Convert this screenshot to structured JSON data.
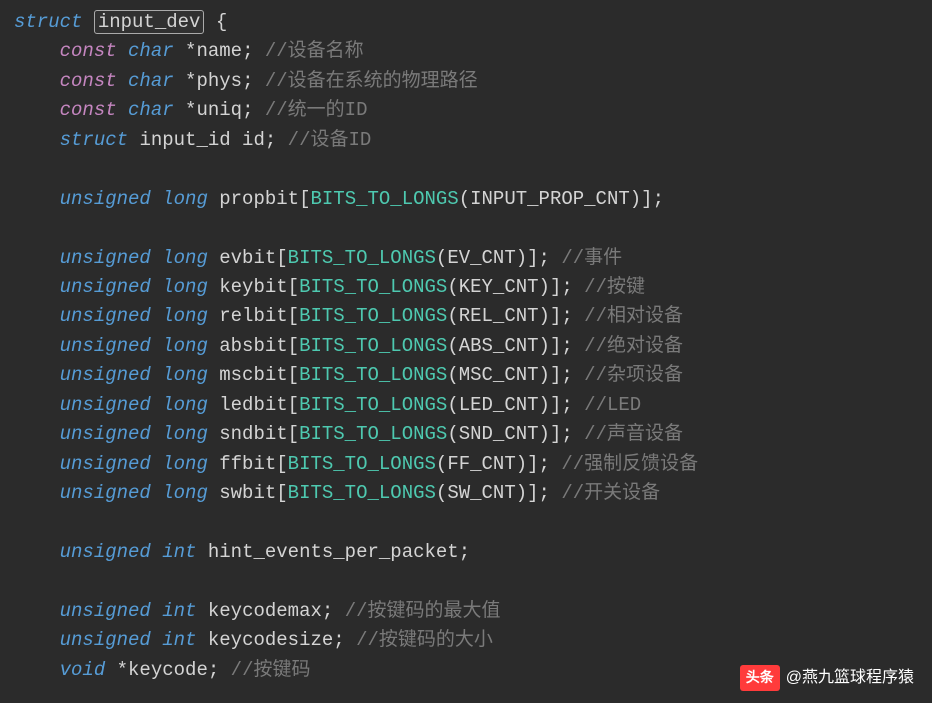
{
  "code": {
    "lines": [
      {
        "indent": 0,
        "parts": [
          {
            "cls": "kw-struct",
            "t": "struct"
          },
          {
            "t": " "
          },
          {
            "cls": "ident boxed",
            "t": "input_dev"
          },
          {
            "t": " "
          },
          {
            "cls": "punct",
            "t": "{"
          }
        ]
      },
      {
        "indent": 1,
        "parts": [
          {
            "cls": "kw-const",
            "t": "const"
          },
          {
            "t": " "
          },
          {
            "cls": "kw-type",
            "t": "char"
          },
          {
            "t": " "
          },
          {
            "cls": "punct",
            "t": "*"
          },
          {
            "cls": "ident",
            "t": "name"
          },
          {
            "cls": "punct",
            "t": ";"
          },
          {
            "t": " "
          },
          {
            "cls": "comment",
            "t": "//设备名称"
          }
        ]
      },
      {
        "indent": 1,
        "parts": [
          {
            "cls": "kw-const",
            "t": "const"
          },
          {
            "t": " "
          },
          {
            "cls": "kw-type",
            "t": "char"
          },
          {
            "t": " "
          },
          {
            "cls": "punct",
            "t": "*"
          },
          {
            "cls": "ident",
            "t": "phys"
          },
          {
            "cls": "punct",
            "t": ";"
          },
          {
            "t": " "
          },
          {
            "cls": "comment",
            "t": "//设备在系统的物理路径"
          }
        ]
      },
      {
        "indent": 1,
        "parts": [
          {
            "cls": "kw-const",
            "t": "const"
          },
          {
            "t": " "
          },
          {
            "cls": "kw-type",
            "t": "char"
          },
          {
            "t": " "
          },
          {
            "cls": "punct",
            "t": "*"
          },
          {
            "cls": "ident",
            "t": "uniq"
          },
          {
            "cls": "punct",
            "t": ";"
          },
          {
            "t": " "
          },
          {
            "cls": "comment",
            "t": "//统一的ID"
          }
        ]
      },
      {
        "indent": 1,
        "parts": [
          {
            "cls": "kw-struct",
            "t": "struct"
          },
          {
            "t": " "
          },
          {
            "cls": "ident",
            "t": "input_id id"
          },
          {
            "cls": "punct",
            "t": ";"
          },
          {
            "t": " "
          },
          {
            "cls": "comment",
            "t": "//设备ID"
          }
        ]
      },
      {
        "indent": 0,
        "parts": [
          {
            "t": " "
          }
        ]
      },
      {
        "indent": 1,
        "parts": [
          {
            "cls": "kw-type",
            "t": "unsigned"
          },
          {
            "t": " "
          },
          {
            "cls": "kw-type",
            "t": "long"
          },
          {
            "t": " "
          },
          {
            "cls": "ident",
            "t": "propbit"
          },
          {
            "cls": "punct",
            "t": "["
          },
          {
            "cls": "func",
            "t": "BITS_TO_LONGS"
          },
          {
            "cls": "punct",
            "t": "("
          },
          {
            "cls": "ident",
            "t": "INPUT_PROP_CNT"
          },
          {
            "cls": "punct",
            "t": ")];"
          }
        ]
      },
      {
        "indent": 0,
        "parts": [
          {
            "t": " "
          }
        ]
      },
      {
        "indent": 1,
        "parts": [
          {
            "cls": "kw-type",
            "t": "unsigned"
          },
          {
            "t": " "
          },
          {
            "cls": "kw-type",
            "t": "long"
          },
          {
            "t": " "
          },
          {
            "cls": "ident",
            "t": "evbit"
          },
          {
            "cls": "punct",
            "t": "["
          },
          {
            "cls": "func",
            "t": "BITS_TO_LONGS"
          },
          {
            "cls": "punct",
            "t": "("
          },
          {
            "cls": "ident",
            "t": "EV_CNT"
          },
          {
            "cls": "punct",
            "t": ")];"
          },
          {
            "t": " "
          },
          {
            "cls": "comment",
            "t": "//事件"
          }
        ]
      },
      {
        "indent": 1,
        "parts": [
          {
            "cls": "kw-type",
            "t": "unsigned"
          },
          {
            "t": " "
          },
          {
            "cls": "kw-type",
            "t": "long"
          },
          {
            "t": " "
          },
          {
            "cls": "ident",
            "t": "keybit"
          },
          {
            "cls": "punct",
            "t": "["
          },
          {
            "cls": "func",
            "t": "BITS_TO_LONGS"
          },
          {
            "cls": "punct",
            "t": "("
          },
          {
            "cls": "ident",
            "t": "KEY_CNT"
          },
          {
            "cls": "punct",
            "t": ")];"
          },
          {
            "t": " "
          },
          {
            "cls": "comment",
            "t": "//按键"
          }
        ]
      },
      {
        "indent": 1,
        "parts": [
          {
            "cls": "kw-type",
            "t": "unsigned"
          },
          {
            "t": " "
          },
          {
            "cls": "kw-type",
            "t": "long"
          },
          {
            "t": " "
          },
          {
            "cls": "ident",
            "t": "relbit"
          },
          {
            "cls": "punct",
            "t": "["
          },
          {
            "cls": "func",
            "t": "BITS_TO_LONGS"
          },
          {
            "cls": "punct",
            "t": "("
          },
          {
            "cls": "ident",
            "t": "REL_CNT"
          },
          {
            "cls": "punct",
            "t": ")];"
          },
          {
            "t": " "
          },
          {
            "cls": "comment",
            "t": "//相对设备"
          }
        ]
      },
      {
        "indent": 1,
        "parts": [
          {
            "cls": "kw-type",
            "t": "unsigned"
          },
          {
            "t": " "
          },
          {
            "cls": "kw-type",
            "t": "long"
          },
          {
            "t": " "
          },
          {
            "cls": "ident",
            "t": "absbit"
          },
          {
            "cls": "punct",
            "t": "["
          },
          {
            "cls": "func",
            "t": "BITS_TO_LONGS"
          },
          {
            "cls": "punct",
            "t": "("
          },
          {
            "cls": "ident",
            "t": "ABS_CNT"
          },
          {
            "cls": "punct",
            "t": ")];"
          },
          {
            "t": " "
          },
          {
            "cls": "comment",
            "t": "//绝对设备"
          }
        ]
      },
      {
        "indent": 1,
        "parts": [
          {
            "cls": "kw-type",
            "t": "unsigned"
          },
          {
            "t": " "
          },
          {
            "cls": "kw-type",
            "t": "long"
          },
          {
            "t": " "
          },
          {
            "cls": "ident",
            "t": "mscbit"
          },
          {
            "cls": "punct",
            "t": "["
          },
          {
            "cls": "func",
            "t": "BITS_TO_LONGS"
          },
          {
            "cls": "punct",
            "t": "("
          },
          {
            "cls": "ident",
            "t": "MSC_CNT"
          },
          {
            "cls": "punct",
            "t": ")];"
          },
          {
            "t": " "
          },
          {
            "cls": "comment",
            "t": "//杂项设备"
          }
        ]
      },
      {
        "indent": 1,
        "parts": [
          {
            "cls": "kw-type",
            "t": "unsigned"
          },
          {
            "t": " "
          },
          {
            "cls": "kw-type",
            "t": "long"
          },
          {
            "t": " "
          },
          {
            "cls": "ident",
            "t": "ledbit"
          },
          {
            "cls": "punct",
            "t": "["
          },
          {
            "cls": "func",
            "t": "BITS_TO_LONGS"
          },
          {
            "cls": "punct",
            "t": "("
          },
          {
            "cls": "ident",
            "t": "LED_CNT"
          },
          {
            "cls": "punct",
            "t": ")];"
          },
          {
            "t": " "
          },
          {
            "cls": "comment",
            "t": "//LED"
          }
        ]
      },
      {
        "indent": 1,
        "parts": [
          {
            "cls": "kw-type",
            "t": "unsigned"
          },
          {
            "t": " "
          },
          {
            "cls": "kw-type",
            "t": "long"
          },
          {
            "t": " "
          },
          {
            "cls": "ident",
            "t": "sndbit"
          },
          {
            "cls": "punct",
            "t": "["
          },
          {
            "cls": "func",
            "t": "BITS_TO_LONGS"
          },
          {
            "cls": "punct",
            "t": "("
          },
          {
            "cls": "ident",
            "t": "SND_CNT"
          },
          {
            "cls": "punct",
            "t": ")];"
          },
          {
            "t": " "
          },
          {
            "cls": "comment",
            "t": "//声音设备"
          }
        ]
      },
      {
        "indent": 1,
        "parts": [
          {
            "cls": "kw-type",
            "t": "unsigned"
          },
          {
            "t": " "
          },
          {
            "cls": "kw-type",
            "t": "long"
          },
          {
            "t": " "
          },
          {
            "cls": "ident",
            "t": "ffbit"
          },
          {
            "cls": "punct",
            "t": "["
          },
          {
            "cls": "func",
            "t": "BITS_TO_LONGS"
          },
          {
            "cls": "punct",
            "t": "("
          },
          {
            "cls": "ident",
            "t": "FF_CNT"
          },
          {
            "cls": "punct",
            "t": ")];"
          },
          {
            "t": " "
          },
          {
            "cls": "comment",
            "t": "//强制反馈设备"
          }
        ]
      },
      {
        "indent": 1,
        "parts": [
          {
            "cls": "kw-type",
            "t": "unsigned"
          },
          {
            "t": " "
          },
          {
            "cls": "kw-type",
            "t": "long"
          },
          {
            "t": " "
          },
          {
            "cls": "ident",
            "t": "swbit"
          },
          {
            "cls": "punct",
            "t": "["
          },
          {
            "cls": "func",
            "t": "BITS_TO_LONGS"
          },
          {
            "cls": "punct",
            "t": "("
          },
          {
            "cls": "ident",
            "t": "SW_CNT"
          },
          {
            "cls": "punct",
            "t": ")];"
          },
          {
            "t": " "
          },
          {
            "cls": "comment",
            "t": "//开关设备"
          }
        ]
      },
      {
        "indent": 0,
        "parts": [
          {
            "t": " "
          }
        ]
      },
      {
        "indent": 1,
        "parts": [
          {
            "cls": "kw-type",
            "t": "unsigned"
          },
          {
            "t": " "
          },
          {
            "cls": "kw-type",
            "t": "int"
          },
          {
            "t": " "
          },
          {
            "cls": "ident",
            "t": "hint_events_per_packet"
          },
          {
            "cls": "punct",
            "t": ";"
          }
        ]
      },
      {
        "indent": 0,
        "parts": [
          {
            "t": " "
          }
        ]
      },
      {
        "indent": 1,
        "parts": [
          {
            "cls": "kw-type",
            "t": "unsigned"
          },
          {
            "t": " "
          },
          {
            "cls": "kw-type",
            "t": "int"
          },
          {
            "t": " "
          },
          {
            "cls": "ident",
            "t": "keycodemax"
          },
          {
            "cls": "punct",
            "t": ";"
          },
          {
            "t": " "
          },
          {
            "cls": "comment",
            "t": "//按键码的最大值"
          }
        ]
      },
      {
        "indent": 1,
        "parts": [
          {
            "cls": "kw-type",
            "t": "unsigned"
          },
          {
            "t": " "
          },
          {
            "cls": "kw-type",
            "t": "int"
          },
          {
            "t": " "
          },
          {
            "cls": "ident",
            "t": "keycodesize"
          },
          {
            "cls": "punct",
            "t": ";"
          },
          {
            "t": " "
          },
          {
            "cls": "comment",
            "t": "//按键码的大小"
          }
        ]
      },
      {
        "indent": 1,
        "parts": [
          {
            "cls": "kw-type",
            "t": "void"
          },
          {
            "t": " "
          },
          {
            "cls": "punct",
            "t": "*"
          },
          {
            "cls": "ident",
            "t": "keycode"
          },
          {
            "cls": "punct",
            "t": ";"
          },
          {
            "t": " "
          },
          {
            "cls": "comment",
            "t": "//按键码"
          }
        ]
      }
    ]
  },
  "watermark": {
    "logo": "头条",
    "text": "@燕九篮球程序猿"
  }
}
